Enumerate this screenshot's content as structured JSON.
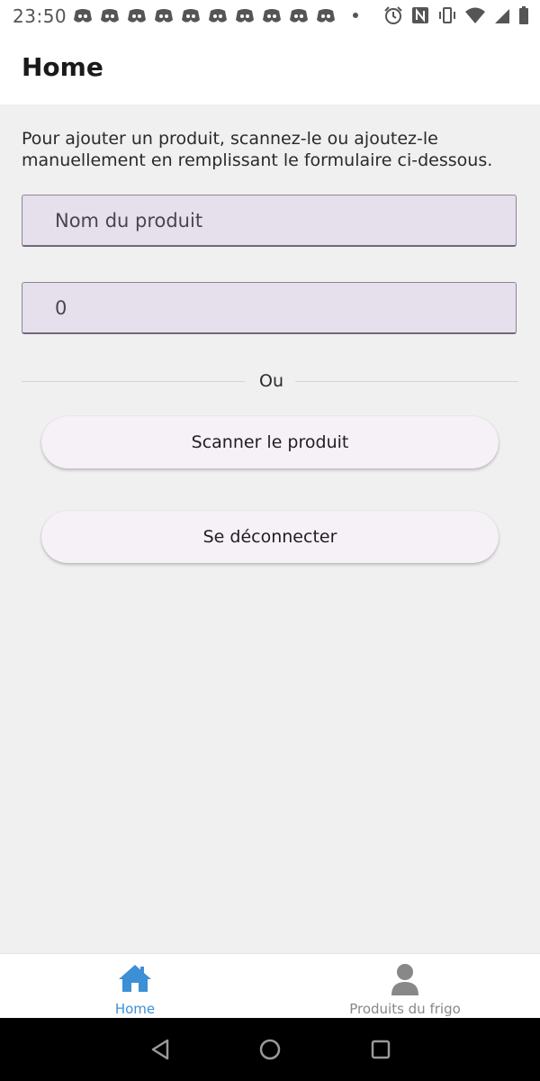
{
  "status_bar": {
    "time": "23:50",
    "notification_icons": [
      "discord-icon",
      "discord-icon",
      "discord-icon",
      "discord-icon",
      "discord-icon",
      "discord-icon",
      "discord-icon",
      "discord-icon",
      "discord-icon",
      "discord-icon"
    ],
    "system_icons": [
      "alarm-icon",
      "nfc-icon",
      "vibrate-icon",
      "wifi-icon",
      "signal-icon",
      "battery-icon"
    ]
  },
  "app_bar": {
    "title": "Home"
  },
  "main": {
    "intro": "Pour ajouter un produit, scannez-le ou ajoutez-le manuellement en remplissant le formulaire ci-dessous.",
    "product_name_placeholder": "Nom du produit",
    "quantity_value": "0",
    "divider_text": "Ou",
    "scan_button_label": "Scanner le produit",
    "logout_button_label": "Se déconnecter"
  },
  "bottom_nav": {
    "items": [
      {
        "label": "Home",
        "icon": "home-icon",
        "active": true
      },
      {
        "label": "Produits du frigo",
        "icon": "person-icon",
        "active": false
      }
    ],
    "active_color": "#3d8fd6",
    "inactive_color": "#888888"
  },
  "colors": {
    "field_background": "#e6dfec",
    "button_background": "#f6f0f7",
    "page_background": "#f0f0f0"
  }
}
